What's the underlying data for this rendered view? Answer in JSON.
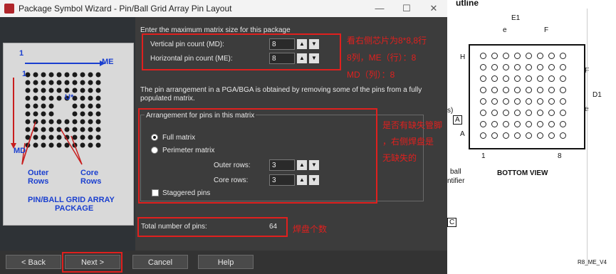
{
  "window": {
    "title": "Package Symbol Wizard - Pin/Ball Grid Array Pin Layout",
    "minimize": "—",
    "maximize": "☐",
    "close": "✕"
  },
  "diagram": {
    "one_top": "1",
    "me": "ME",
    "one_left": "1",
    "u": "U*",
    "md": "MD",
    "outer": "Outer",
    "outer2": "Rows",
    "core": "Core",
    "core2": "Rows",
    "title1": "PIN/BALL GRID ARRAY",
    "title2": "PACKAGE"
  },
  "matrix": {
    "heading": "Enter the maximum matrix size for this package",
    "vertical_label": "Vertical pin count (MD):",
    "vertical_value": "8",
    "horizontal_label": "Horizontal pin count (ME):",
    "horizontal_value": "8"
  },
  "annotation1": {
    "line1": "看右侧芯片为8*8,8行",
    "line2": "8列，ME（行）：8",
    "line3": "MD（列）：8"
  },
  "info": {
    "line1": "The pin arrangement in a PGA/BGA is obtained by removing some of the pins from a fully",
    "line2": "populated matrix."
  },
  "arrangement": {
    "legend": "Arrangement for pins in this matrix",
    "full_matrix": "Full matrix",
    "perimeter_matrix": "Perimeter matrix",
    "outer_rows_label": "Outer rows:",
    "outer_rows_value": "3",
    "core_rows_label": "Core rows:",
    "core_rows_value": "3",
    "staggered": "Staggered pins"
  },
  "annotation2": {
    "line1": "是否有缺失管脚",
    "line2": "，右侧焊盘是",
    "line3": "无缺失的"
  },
  "total": {
    "label": "Total number of pins:",
    "value": "64"
  },
  "annotation3": "焊盘个数",
  "buttons": {
    "back": "< Back",
    "next": "Next >",
    "cancel": "Cancel",
    "help": "Help"
  },
  "datasheet": {
    "header": "utline",
    "e1": "E1",
    "e": "e",
    "f": "F",
    "h": "H",
    "f2": "F",
    "d1": "D1",
    "e2": "e",
    "a": "A",
    "one": "1",
    "eight": "8",
    "bottom_view": "BOTTOM VIEW",
    "ball": "ball",
    "ntifier": "ntifier",
    "s": "s)",
    "ref_a": "A",
    "c": "C",
    "code": "R8_ME_V4"
  }
}
